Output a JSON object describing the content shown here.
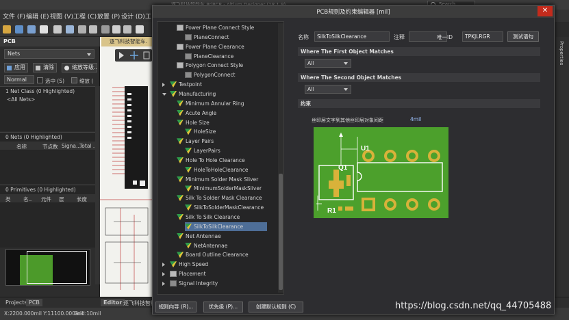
{
  "app": {
    "title": "逐飞科技智能车.PrjPCB - Altium Designer (18.1.9)",
    "search_placeholder": "Search"
  },
  "menu": [
    "文件 (F)",
    "编辑 (E)",
    "视图 (V)",
    "工程 (C)",
    "放置 (P)",
    "设计 (D)",
    "工"
  ],
  "pcb_panel": {
    "title": "PCB",
    "mode": "Nets",
    "buttons": {
      "apply": "应用",
      "clear": "清除",
      "zoom": "缩放等级..."
    },
    "highlight_mode": "Normal",
    "checks": {
      "select": "选中 (S)",
      "zoom": "缩放 ("
    },
    "net_class": {
      "summary": "1 Net Class (0 Highlighted)",
      "item": "<All Nets>"
    },
    "nets": {
      "summary": "0 Nets (0 Highlighted)",
      "columns": [
        "名称",
        "节点数",
        "Signa...",
        "Total ..."
      ]
    },
    "primitives": {
      "summary": "0 Primitives (0 Highlighted)",
      "columns": [
        "类",
        "名..",
        "元件",
        "层",
        "长度"
      ]
    }
  },
  "document_tab": "逐飞科技智能车.",
  "right_panel_label": "Properties",
  "bottom_tabs": {
    "projects": "Projects",
    "pcb": "PCB",
    "editor": "Editor",
    "doc": "逐飞科技智能"
  },
  "status": {
    "coords": "X:2200.000mil Y:11100.000mil",
    "grid": "Grid:10mil"
  },
  "dialog": {
    "title": "PCB规则及约束编辑器 [mil]",
    "tree": [
      {
        "label": "Power Plane Connect Style",
        "level": 2,
        "icon": "grid-icon"
      },
      {
        "label": "PlaneConnect",
        "level": 3,
        "icon": "sub-icon"
      },
      {
        "label": "Power Plane Clearance",
        "level": 2,
        "icon": "grid-icon"
      },
      {
        "label": "PlaneClearance",
        "level": 3,
        "icon": "sub-icon"
      },
      {
        "label": "Polygon Connect Style",
        "level": 2,
        "icon": "grid-icon"
      },
      {
        "label": "PolygonConnect",
        "level": 3,
        "icon": "sub-icon"
      },
      {
        "label": "Testpoint",
        "level": 1,
        "icon": "testpoint-icon",
        "collapsed": true
      },
      {
        "label": "Manufacturing",
        "level": 1,
        "icon": "rule-icon"
      },
      {
        "label": "Minimum Annular Ring",
        "level": 2,
        "icon": "rule-icon"
      },
      {
        "label": "Acute Angle",
        "level": 2,
        "icon": "rule-icon"
      },
      {
        "label": "Hole Size",
        "level": 2,
        "icon": "rule-icon"
      },
      {
        "label": "HoleSize",
        "level": 3,
        "icon": "rule-icon"
      },
      {
        "label": "Layer Pairs",
        "level": 2,
        "icon": "rule-icon"
      },
      {
        "label": "LayerPairs",
        "level": 3,
        "icon": "rule-icon"
      },
      {
        "label": "Hole To Hole Clearance",
        "level": 2,
        "icon": "rule-icon"
      },
      {
        "label": "HoleToHoleClearance",
        "level": 3,
        "icon": "rule-icon"
      },
      {
        "label": "Minimum Solder Mask Sliver",
        "level": 2,
        "icon": "rule-icon"
      },
      {
        "label": "MinimumSolderMaskSliver",
        "level": 3,
        "icon": "rule-icon"
      },
      {
        "label": "Silk To Solder Mask Clearance",
        "level": 2,
        "icon": "rule-icon"
      },
      {
        "label": "SilkToSolderMaskClearance",
        "level": 3,
        "icon": "rule-icon"
      },
      {
        "label": "Silk To Silk Clearance",
        "level": 2,
        "icon": "rule-icon"
      },
      {
        "label": "SilkToSilkClearance",
        "level": 3,
        "icon": "rule-icon",
        "selected": true
      },
      {
        "label": "Net Antennae",
        "level": 2,
        "icon": "rule-icon"
      },
      {
        "label": "NetAntennae",
        "level": 3,
        "icon": "rule-icon"
      },
      {
        "label": "Board Outline Clearance",
        "level": 2,
        "icon": "rule-icon"
      },
      {
        "label": "High Speed",
        "level": 1,
        "icon": "highspeed-icon",
        "collapsed": true
      },
      {
        "label": "Placement",
        "level": 1,
        "icon": "placement-icon",
        "collapsed": true
      },
      {
        "label": "Signal Integrity",
        "level": 1,
        "icon": "signal-icon",
        "collapsed": true
      }
    ],
    "rule": {
      "name_label": "名称",
      "name_value": "SilkToSilkClearance",
      "comment_label": "注释",
      "comment_value": "",
      "unique_id_label": "唯一ID",
      "unique_id_value": "TPKJLRGR",
      "test_button": "测试语句",
      "first_match_header": "Where The First Object Matches",
      "first_match_value": "All",
      "second_match_header": "Where The Second Object Matches",
      "second_match_value": "All",
      "constraints_header": "约束",
      "constraint_label": "丝印层文字到其他丝印层对象间距",
      "constraint_value": "4mil",
      "illustration_labels": {
        "u1": "U1",
        "q1": "Q1",
        "r1": "R1"
      }
    },
    "footer": {
      "wizard": "规则向导 (R)...",
      "priority": "优先级 (P)...",
      "create_default": "创建默认规则 (C)"
    }
  },
  "watermark": "https://blog.csdn.net/qq_44705488",
  "colors": {
    "pcb_green": "#4ca02c",
    "pad_gold": "#d8b23a",
    "close_red": "#c42b1c",
    "selection": "#4e6e97"
  }
}
